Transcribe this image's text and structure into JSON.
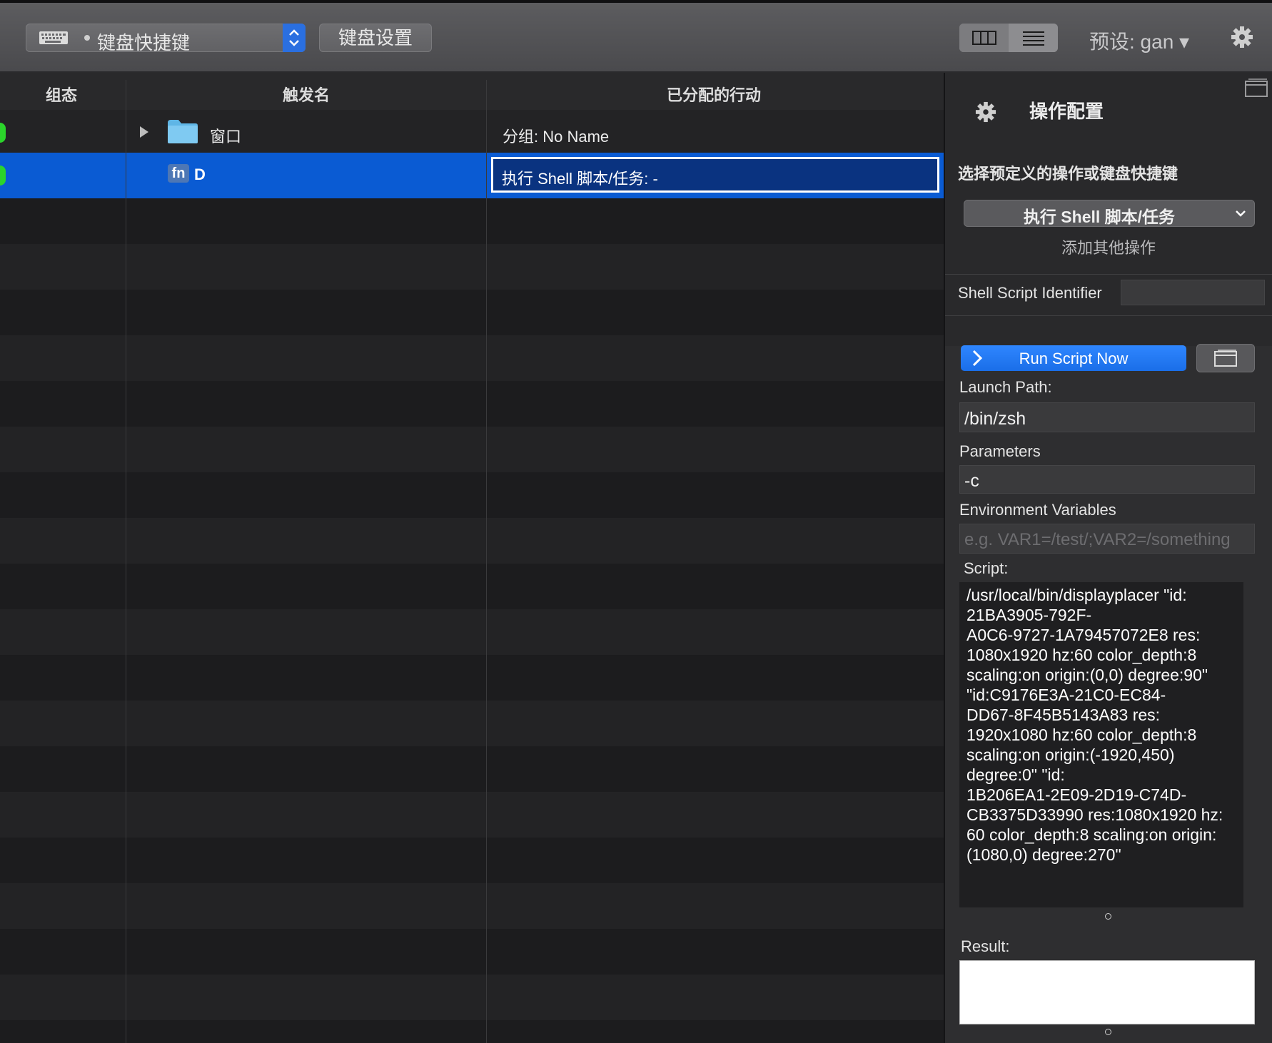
{
  "toolbar": {
    "trigger_type": "键盘快捷键",
    "keyboard_settings": "键盘设置",
    "preset": "预设: gan ▾"
  },
  "table": {
    "columns": {
      "state": "组态",
      "trigger": "触发名",
      "action": "已分配的行动"
    },
    "rows": [
      {
        "trigger": "窗口",
        "action": "分组: No Name",
        "kind": "folder"
      },
      {
        "trigger": "D",
        "badge": "fn",
        "action": "执行 Shell 脚本/任务: -",
        "selected": true
      }
    ]
  },
  "panel": {
    "title": "操作配置",
    "choose_label": "选择预定义的操作或键盘快捷键",
    "action_selected": "执行 Shell 脚本/任务",
    "add_other": "添加其他操作",
    "identifier_label": "Shell Script Identifier",
    "identifier_value": "",
    "run_button": "Run Script Now",
    "launch_path_label": "Launch Path:",
    "launch_path_value": "/bin/zsh",
    "parameters_label": "Parameters",
    "parameters_value": "-c",
    "env_label": "Environment Variables",
    "env_placeholder": "e.g. VAR1=/test/;VAR2=/something",
    "script_label": "Script:",
    "script_value": "/usr/local/bin/displayplacer \"id:\n21BA3905-792F-\nA0C6-9727-1A79457072E8 res:\n1080x1920 hz:60 color_depth:8\nscaling:on origin:(0,0) degree:90\"\n\"id:C9176E3A-21C0-EC84-\nDD67-8F45B5143A83 res:\n1920x1080 hz:60 color_depth:8\nscaling:on origin:(-1920,450)\ndegree:0\" \"id:\n1B206EA1-2E09-2D19-C74D-\nCB3375D33990 res:1080x1920 hz:\n60 color_depth:8 scaling:on origin:\n(1080,0) degree:270\"",
    "result_label": "Result:",
    "result_value": ""
  },
  "icons": [
    "keyboard-icon",
    "chevron-updown-icon",
    "columns-view-icon",
    "list-view-icon",
    "gear-icon",
    "disclosure-triangle-icon",
    "folder-icon",
    "window-icon",
    "chevron-down-icon",
    "chevron-right-icon"
  ]
}
